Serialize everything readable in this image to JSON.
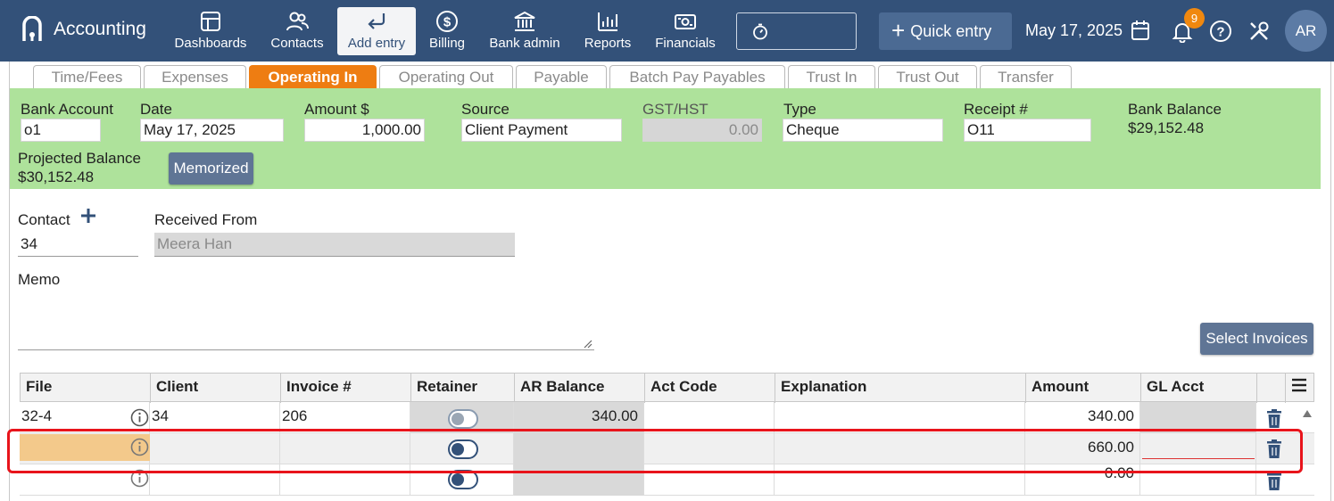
{
  "app": {
    "title": "Accounting"
  },
  "nav": [
    {
      "label": "Dashboards",
      "icon": "dashboards-icon"
    },
    {
      "label": "Contacts",
      "icon": "contacts-icon"
    },
    {
      "label": "Add entry",
      "icon": "add-entry-icon",
      "active": true
    },
    {
      "label": "Billing",
      "icon": "billing-icon"
    },
    {
      "label": "Bank admin",
      "icon": "bank-icon"
    },
    {
      "label": "Reports",
      "icon": "reports-icon"
    },
    {
      "label": "Financials",
      "icon": "financials-icon"
    }
  ],
  "header": {
    "quick_entry": "Quick entry",
    "date": "May 17, 2025",
    "notifications": "9",
    "avatar": "AR"
  },
  "tabs": [
    {
      "label": "Time/Fees"
    },
    {
      "label": "Expenses"
    },
    {
      "label": "Operating In",
      "active": true
    },
    {
      "label": "Operating Out"
    },
    {
      "label": "Payable"
    },
    {
      "label": "Batch Pay Payables"
    },
    {
      "label": "Trust In"
    },
    {
      "label": "Trust Out"
    },
    {
      "label": "Transfer"
    }
  ],
  "entry": {
    "bank_account_label": "Bank Account",
    "bank_account": "o1",
    "date_label": "Date",
    "date": "May 17, 2025",
    "amount_label": "Amount $",
    "amount": "1,000.00",
    "source_label": "Source",
    "source": "Client Payment",
    "gst_label": "GST/HST",
    "gst": "0.00",
    "type_label": "Type",
    "type": "Cheque",
    "receipt_label": "Receipt #",
    "receipt": "O11",
    "bank_balance_label": "Bank Balance",
    "bank_balance": "$29,152.48",
    "projected_balance_label": "Projected Balance",
    "projected_balance": "$30,152.48",
    "memorized_button": "Memorized"
  },
  "contact": {
    "contact_label": "Contact",
    "contact_value": "34",
    "received_from_label": "Received From",
    "received_from": "Meera Han",
    "memo_label": "Memo",
    "select_invoices_button": "Select Invoices"
  },
  "table": {
    "columns": [
      "File",
      "Client",
      "Invoice #",
      "Retainer",
      "AR Balance",
      "Act Code",
      "Explanation",
      "Amount",
      "GL Acct"
    ],
    "rows": [
      {
        "file": "32-4",
        "client": "34",
        "invoice": "206",
        "ar_balance": "340.00",
        "act_code": "",
        "explanation": "",
        "amount": "340.00",
        "gl": ""
      },
      {
        "file": "",
        "client": "",
        "invoice": "",
        "ar_balance": "",
        "act_code": "",
        "explanation": "",
        "amount": "660.00",
        "gl": ""
      },
      {
        "file": "",
        "client": "",
        "invoice": "",
        "ar_balance": "",
        "act_code": "",
        "explanation": "",
        "amount": "0.00",
        "gl": ""
      }
    ]
  },
  "colors": {
    "topbar": "#335179",
    "active_tab": "#ee7d12",
    "green_panel": "#aee29b",
    "button": "#5f7595",
    "highlight": "#e8141b",
    "badge": "#f0880f",
    "file_cell_highlight": "#f3c98b"
  }
}
